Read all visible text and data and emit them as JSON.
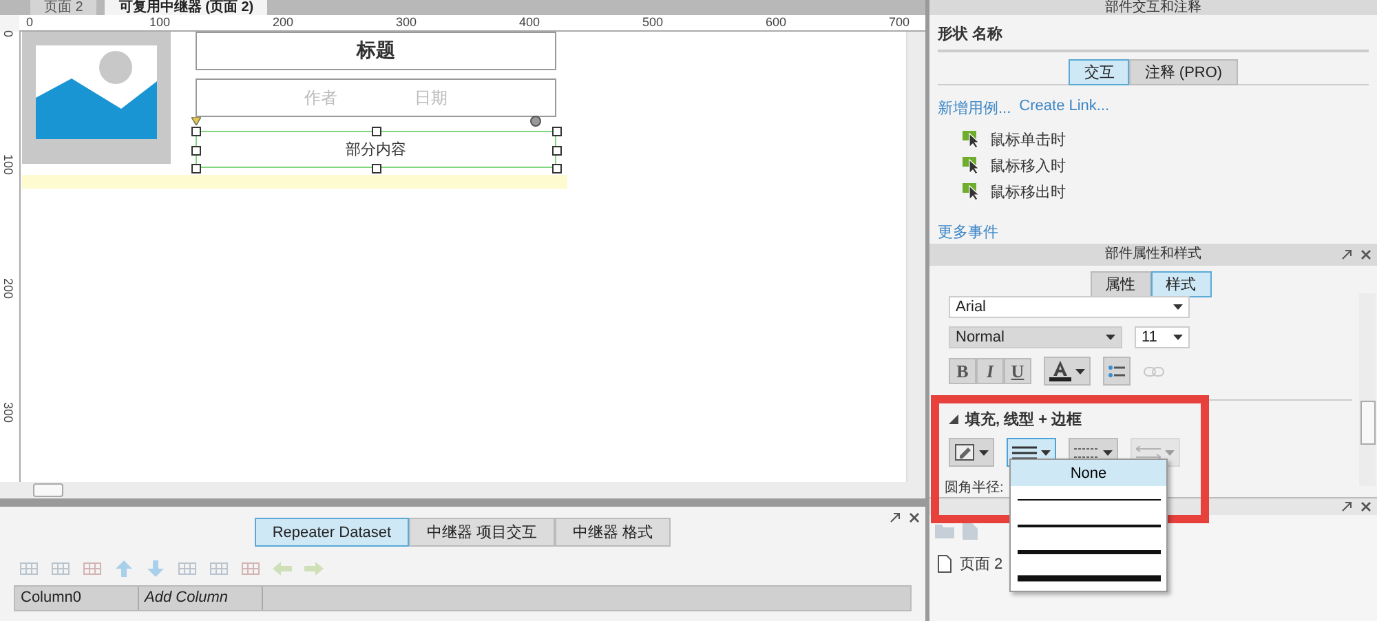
{
  "document_tabs": [
    {
      "label": "页面 2",
      "selected": false
    },
    {
      "label": "可复用中继器 (页面 2)",
      "selected": true
    }
  ],
  "ruler": {
    "x_labels": [
      "0",
      "100",
      "200",
      "300",
      "400",
      "500",
      "600",
      "700"
    ],
    "y_labels": [
      "0",
      "100",
      "200",
      "300"
    ]
  },
  "canvas": {
    "widgets": [
      {
        "kind": "image"
      },
      {
        "kind": "title",
        "text": "标题"
      },
      {
        "kind": "meta",
        "texts": [
          "作者",
          "日期"
        ]
      },
      {
        "kind": "content",
        "text": "部分内容",
        "selected": true
      }
    ]
  },
  "bottom_panel": {
    "tabs": [
      {
        "label": "Repeater Dataset",
        "selected": true
      },
      {
        "label": "中继器 项目交互",
        "selected": false
      },
      {
        "label": "中继器 格式",
        "selected": false
      }
    ],
    "columns": [
      {
        "label": "Column0",
        "kind": "column"
      },
      {
        "label": "Add Column",
        "kind": "add"
      }
    ]
  },
  "interactions_panel": {
    "title": "部件交互和注释",
    "name_label": "形状 名称",
    "tabs": [
      {
        "label": "交互",
        "selected": true
      },
      {
        "label": "注释 (PRO)",
        "selected": false
      }
    ],
    "links": [
      "新增用例...",
      "Create Link..."
    ],
    "events": [
      "鼠标单击时",
      "鼠标移入时",
      "鼠标移出时"
    ],
    "more_events": "更多事件"
  },
  "style_panel": {
    "title": "部件属性和样式",
    "tabs": [
      {
        "label": "属性",
        "selected": false
      },
      {
        "label": "样式",
        "selected": true
      }
    ],
    "font_family": "Arial",
    "font_style": "Normal",
    "font_size": "11",
    "format_buttons": [
      "B",
      "I",
      "U"
    ],
    "section": {
      "label": "填充, 线型 + 边框",
      "expanded": true
    },
    "corner_label": "圆角半径:"
  },
  "line_menu": {
    "items": [
      {
        "kind": "none",
        "label": "None",
        "selected": true
      },
      {
        "kind": "thin",
        "selected": false
      },
      {
        "kind": "medium",
        "selected": false
      },
      {
        "kind": "thick",
        "selected": false
      },
      {
        "kind": "heavy",
        "selected": false
      }
    ]
  },
  "pages_panel": {
    "pages": [
      "页面 2"
    ]
  }
}
